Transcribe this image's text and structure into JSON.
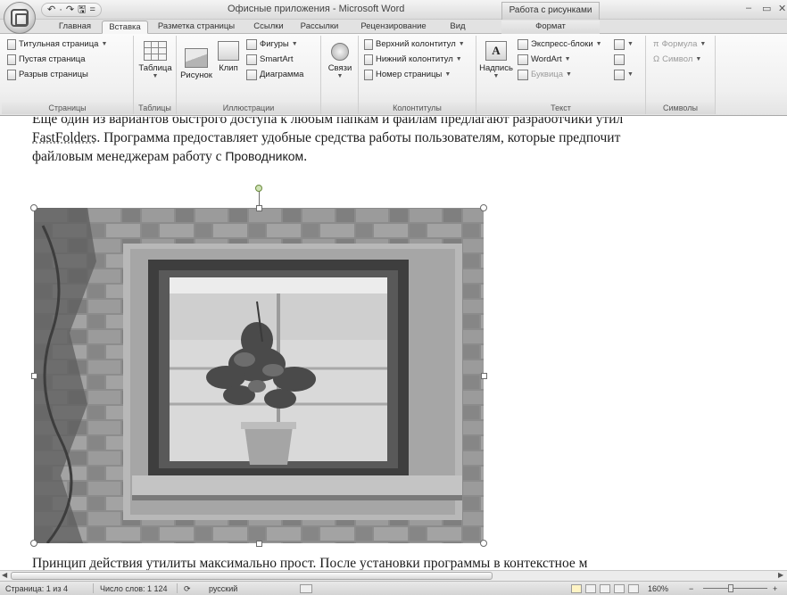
{
  "window": {
    "title": "Офисные приложения - Microsoft Word",
    "context_group": "Работа с рисунками",
    "controls": [
      "–",
      "▭",
      "✕"
    ]
  },
  "quick_access": [
    "↶",
    "·",
    "↷",
    "🖫",
    "="
  ],
  "tabs": [
    {
      "label": "Главная",
      "active": false
    },
    {
      "label": "Вставка",
      "active": true
    },
    {
      "label": "Разметка страницы",
      "active": false
    },
    {
      "label": "Ссылки",
      "active": false
    },
    {
      "label": "Рассылки",
      "active": false
    },
    {
      "label": "Рецензирование",
      "active": false
    },
    {
      "label": "Вид",
      "active": false
    },
    {
      "label": "Формат",
      "active": false,
      "contextual": true
    }
  ],
  "ribbon": {
    "pages": {
      "label": "Страницы",
      "items": [
        "Титульная страница",
        "Пустая страница",
        "Разрыв страницы"
      ]
    },
    "tables": {
      "label": "Таблицы",
      "button": "Таблица"
    },
    "illustrations": {
      "label": "Иллюстрации",
      "picture": "Рисунок",
      "clip": "Клип",
      "shapes": "Фигуры",
      "smartart": "SmartArt",
      "chart": "Диаграмма"
    },
    "links": {
      "label": "",
      "button": "Связи"
    },
    "headers": {
      "label": "Колонтитулы",
      "items": [
        "Верхний колонтитул",
        "Нижний колонтитул",
        "Номер страницы"
      ]
    },
    "text": {
      "label": "Текст",
      "textbox": "Надпись",
      "textbox_glyph": "A",
      "items": [
        "Экспресс-блоки",
        "WordArt",
        "Буквица"
      ]
    },
    "symbols": {
      "label": "Символы",
      "formula": "Формула",
      "symbol": "Символ",
      "formula_glyph": "π",
      "symbol_glyph": "Ω"
    }
  },
  "document": {
    "para1_line1": "Еще один из вариантов быстрого доступа к любым папкам и файлам предлагают разработчики утил",
    "para1_link": "FastFolders",
    "para1_line2_rest": ". Программа предоставляет удобные средства работы пользователям, которые предпочит",
    "para1_line3_start": "файловым менеджерам работу с ",
    "para1_explorer": "Проводником",
    "para1_line3_end": ".",
    "para2_line1": "Принцип действия утилиты максимально прост. После установки программы в контекстное м"
  },
  "statusbar": {
    "page": "Страница: 1 из 4",
    "words": "Число слов: 1 124",
    "language": "русский",
    "zoom": "160%",
    "zoom_minus": "−",
    "zoom_plus": "+"
  },
  "colors": {
    "ribbon_bg": "#f0f0f0",
    "doc_bg": "#ffffff",
    "selection_handle": "#6b6b6b"
  }
}
